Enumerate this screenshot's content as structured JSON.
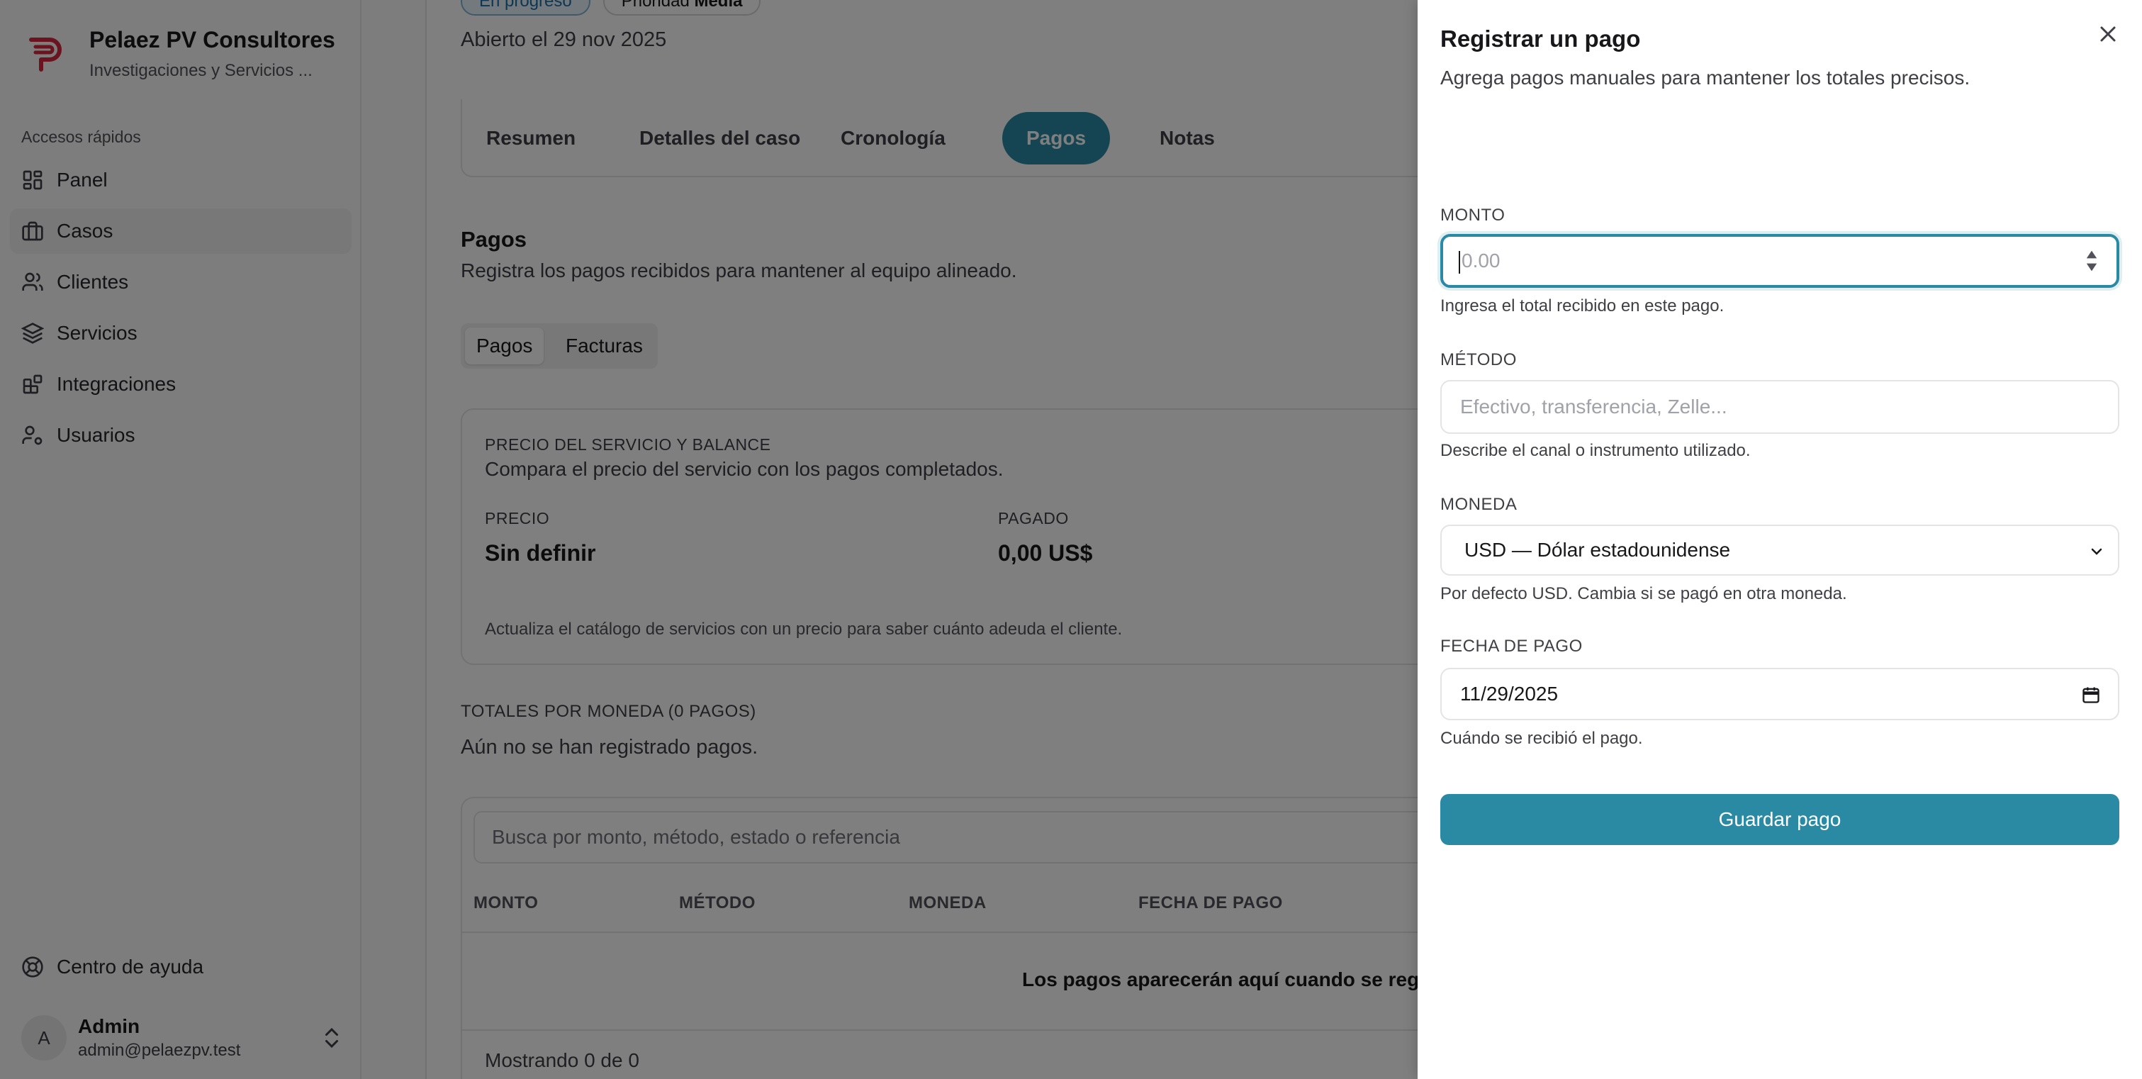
{
  "sidebar": {
    "brand_name": "Pelaez PV Consultores",
    "brand_sub": "Investigaciones y Servicios ...",
    "section_label": "Accesos rápidos",
    "items": [
      {
        "label": "Panel",
        "icon": "dashboard-icon"
      },
      {
        "label": "Casos",
        "icon": "briefcase-icon"
      },
      {
        "label": "Clientes",
        "icon": "users-icon"
      },
      {
        "label": "Servicios",
        "icon": "layers-icon"
      },
      {
        "label": "Integraciones",
        "icon": "blocks-icon"
      },
      {
        "label": "Usuarios",
        "icon": "user-cog-icon"
      }
    ],
    "help_label": "Centro de ayuda",
    "user": {
      "initial": "A",
      "name": "Admin",
      "email": "admin@pelaezpv.test"
    }
  },
  "main": {
    "status_badge": "En progreso",
    "priority_prefix": "Prioridad",
    "priority_value": "Media",
    "opened": "Abierto el 29 nov 2025",
    "tabs": [
      {
        "label": "Resumen"
      },
      {
        "label": "Detalles del caso"
      },
      {
        "label": "Cronología"
      },
      {
        "label": "Pagos"
      },
      {
        "label": "Notas"
      }
    ],
    "pagos_title": "Pagos",
    "pagos_sub": "Registra los pagos recibidos para mantener al equipo alineado.",
    "subtabs": [
      {
        "label": "Pagos"
      },
      {
        "label": "Facturas"
      }
    ],
    "price_card": {
      "label": "PRECIO DEL SERVICIO Y BALANCE",
      "desc": "Compara el precio del servicio con los pagos completados.",
      "price_label": "PRECIO",
      "price_value": "Sin definir",
      "paid_label": "PAGADO",
      "paid_value": "0,00 US$",
      "note": "Actualiza el catálogo de servicios con un precio para saber cuánto adeuda el cliente."
    },
    "totals_label": "TOTALES POR MONEDA (0 PAGOS)",
    "totals_empty": "Aún no se han registrado pagos.",
    "search_placeholder": "Busca por monto, método, estado o referencia",
    "columns": [
      "MONTO",
      "MÉTODO",
      "MONEDA",
      "FECHA DE PAGO"
    ],
    "empty_row": "Los pagos aparecerán aquí cuando se regis",
    "showing": "Mostrando 0 de 0"
  },
  "sheet": {
    "title": "Registrar un pago",
    "desc": "Agrega pagos manuales para mantener los totales precisos.",
    "amount": {
      "label": "MONTO",
      "placeholder": "0.00",
      "help": "Ingresa el total recibido en este pago."
    },
    "method": {
      "label": "MÉTODO",
      "placeholder": "Efectivo, transferencia, Zelle...",
      "help": "Describe el canal o instrumento utilizado."
    },
    "currency": {
      "label": "MONEDA",
      "value": "USD — Dólar estadounidense",
      "help": "Por defecto USD. Cambia si se pagó en otra moneda."
    },
    "date": {
      "label": "FECHA DE PAGO",
      "value": "11/29/2025",
      "help": "Cuándo se recibió el pago."
    },
    "save_label": "Guardar pago"
  },
  "colors": {
    "accent": "#2a8aa4",
    "brand_red": "#d7263d"
  }
}
